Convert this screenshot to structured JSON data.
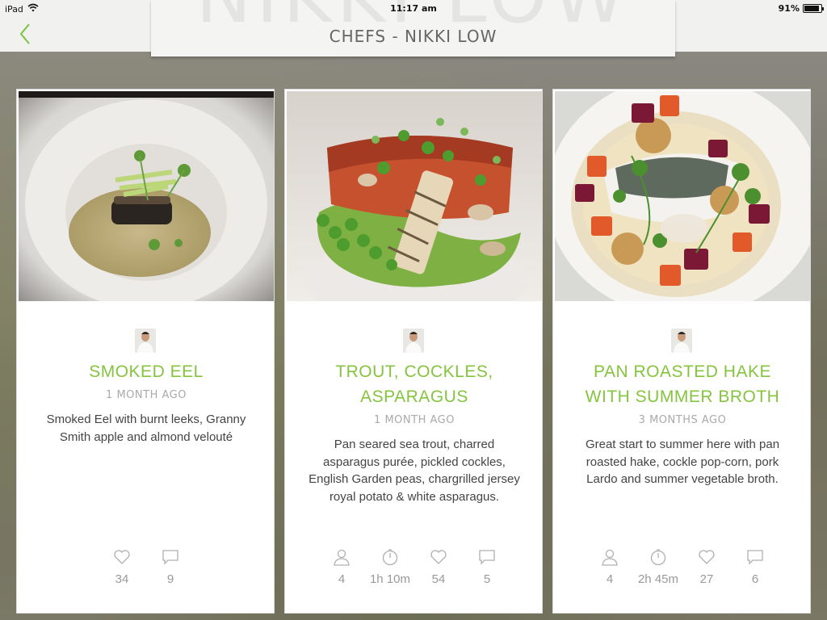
{
  "status_bar": {
    "device": "iPad",
    "time": "11:17 am",
    "battery": "91%",
    "battery_level": 0.91
  },
  "header": {
    "title": "CHEFS - NIKKI LOW",
    "watermark": "NIKKI LOW"
  },
  "cards": [
    {
      "title": "SMOKED EEL",
      "time_ago": "1 MONTH AGO",
      "description": "Smoked Eel with burnt leeks, Granny Smith apple and almond velouté",
      "stats": {
        "likes": "34",
        "comments": "9"
      }
    },
    {
      "title": "TROUT, COCKLES, ASPARAGUS",
      "time_ago": "1 MONTH AGO",
      "description": "Pan seared sea trout, charred asparagus purée, pickled cockles, English Garden peas, chargrilled jersey royal potato & white asparagus.",
      "stats": {
        "serves": "4",
        "time": "1h 10m",
        "likes": "54",
        "comments": "5"
      }
    },
    {
      "title": "PAN ROASTED HAKE WITH SUMMER BROTH",
      "time_ago": "3 MONTHS AGO",
      "description": "Great start to summer here with pan roasted hake, cockle pop-corn, pork Lardo and summer vegetable broth.",
      "stats": {
        "serves": "4",
        "time": "2h 45m",
        "likes": "27",
        "comments": "6"
      }
    }
  ],
  "colors": {
    "accent": "#86c440",
    "muted": "#aaaaaa",
    "icon": "#b0b0b0"
  },
  "icons": [
    "back-chevron-icon",
    "wifi-icon",
    "battery-icon",
    "person-icon",
    "clock-icon",
    "heart-icon",
    "comment-icon"
  ]
}
